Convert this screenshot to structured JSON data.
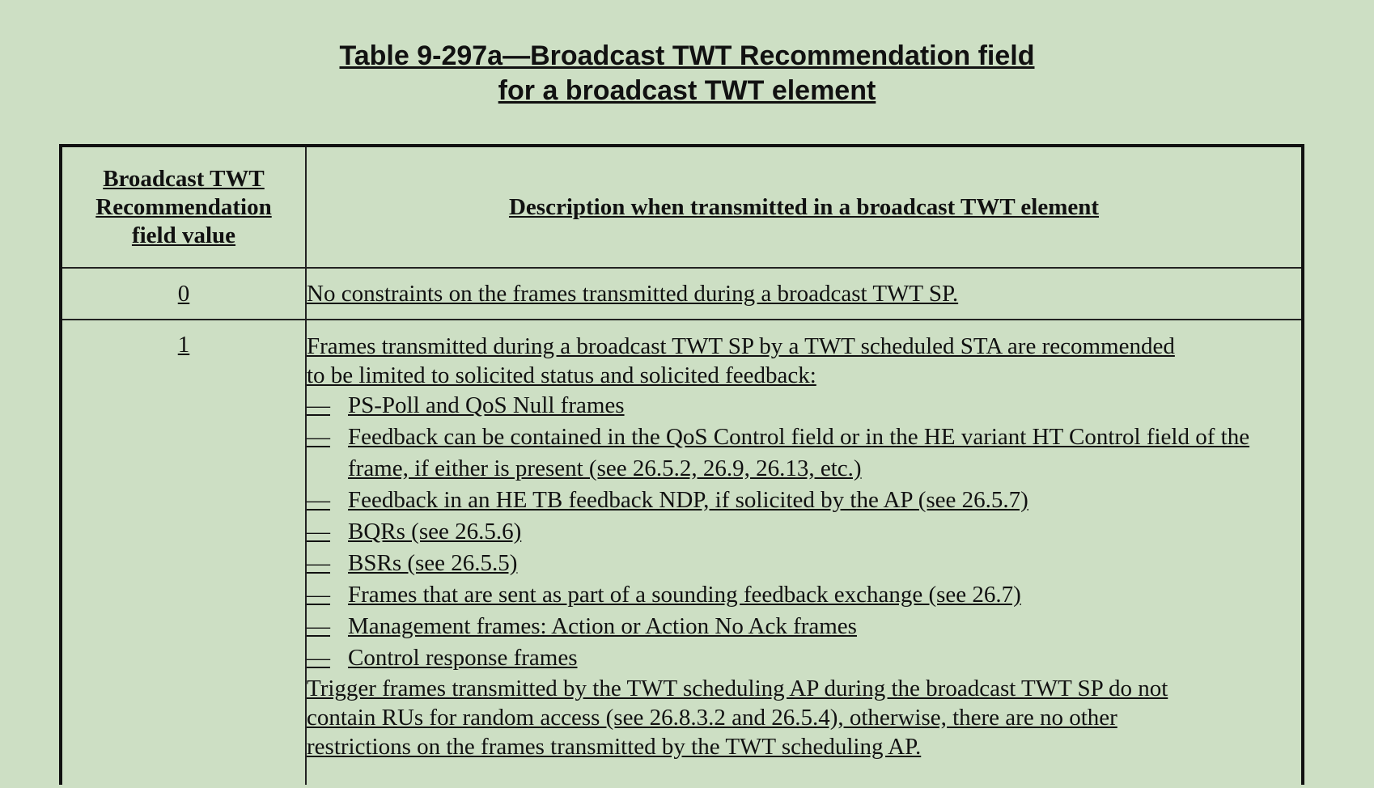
{
  "title": {
    "line1": "Table 9-297a—Broadcast TWT Recommendation field",
    "line2": "for a broadcast TWT element"
  },
  "table": {
    "header": {
      "col1": [
        "Broadcast TWT",
        "Recommendation",
        "field value"
      ],
      "col2": "Description when transmitted in a broadcast TWT element"
    },
    "rows": [
      {
        "value": "0",
        "description": "No constraints on the frames transmitted during a broadcast TWT SP."
      },
      {
        "value": "1",
        "intro": [
          "Frames transmitted during a broadcast TWT SP by a TWT scheduled STA are recommended",
          "to be limited to solicited status and solicited feedback:"
        ],
        "dash": "—",
        "bullets": [
          "PS-Poll and QoS Null frames",
          "Feedback can be contained in the QoS Control field or in the HE variant HT Control field of the frame, if either is present (see 26.5.2, 26.9, 26.13, etc.)",
          "Feedback in an HE TB feedback NDP, if solicited by the AP (see 26.5.7)",
          "BQRs (see 26.5.6)",
          "BSRs (see 26.5.5)",
          "Frames that are sent as part of a sounding feedback exchange (see 26.7)",
          "Management frames: Action or Action No Ack frames",
          "Control response frames"
        ],
        "outro": [
          "Trigger frames transmitted by the TWT scheduling AP during the broadcast TWT SP do not",
          "contain RUs for random access (see 26.8.3.2 and 26.5.4), otherwise, there are no other",
          "restrictions on the frames transmitted by the TWT scheduling AP."
        ]
      }
    ]
  }
}
